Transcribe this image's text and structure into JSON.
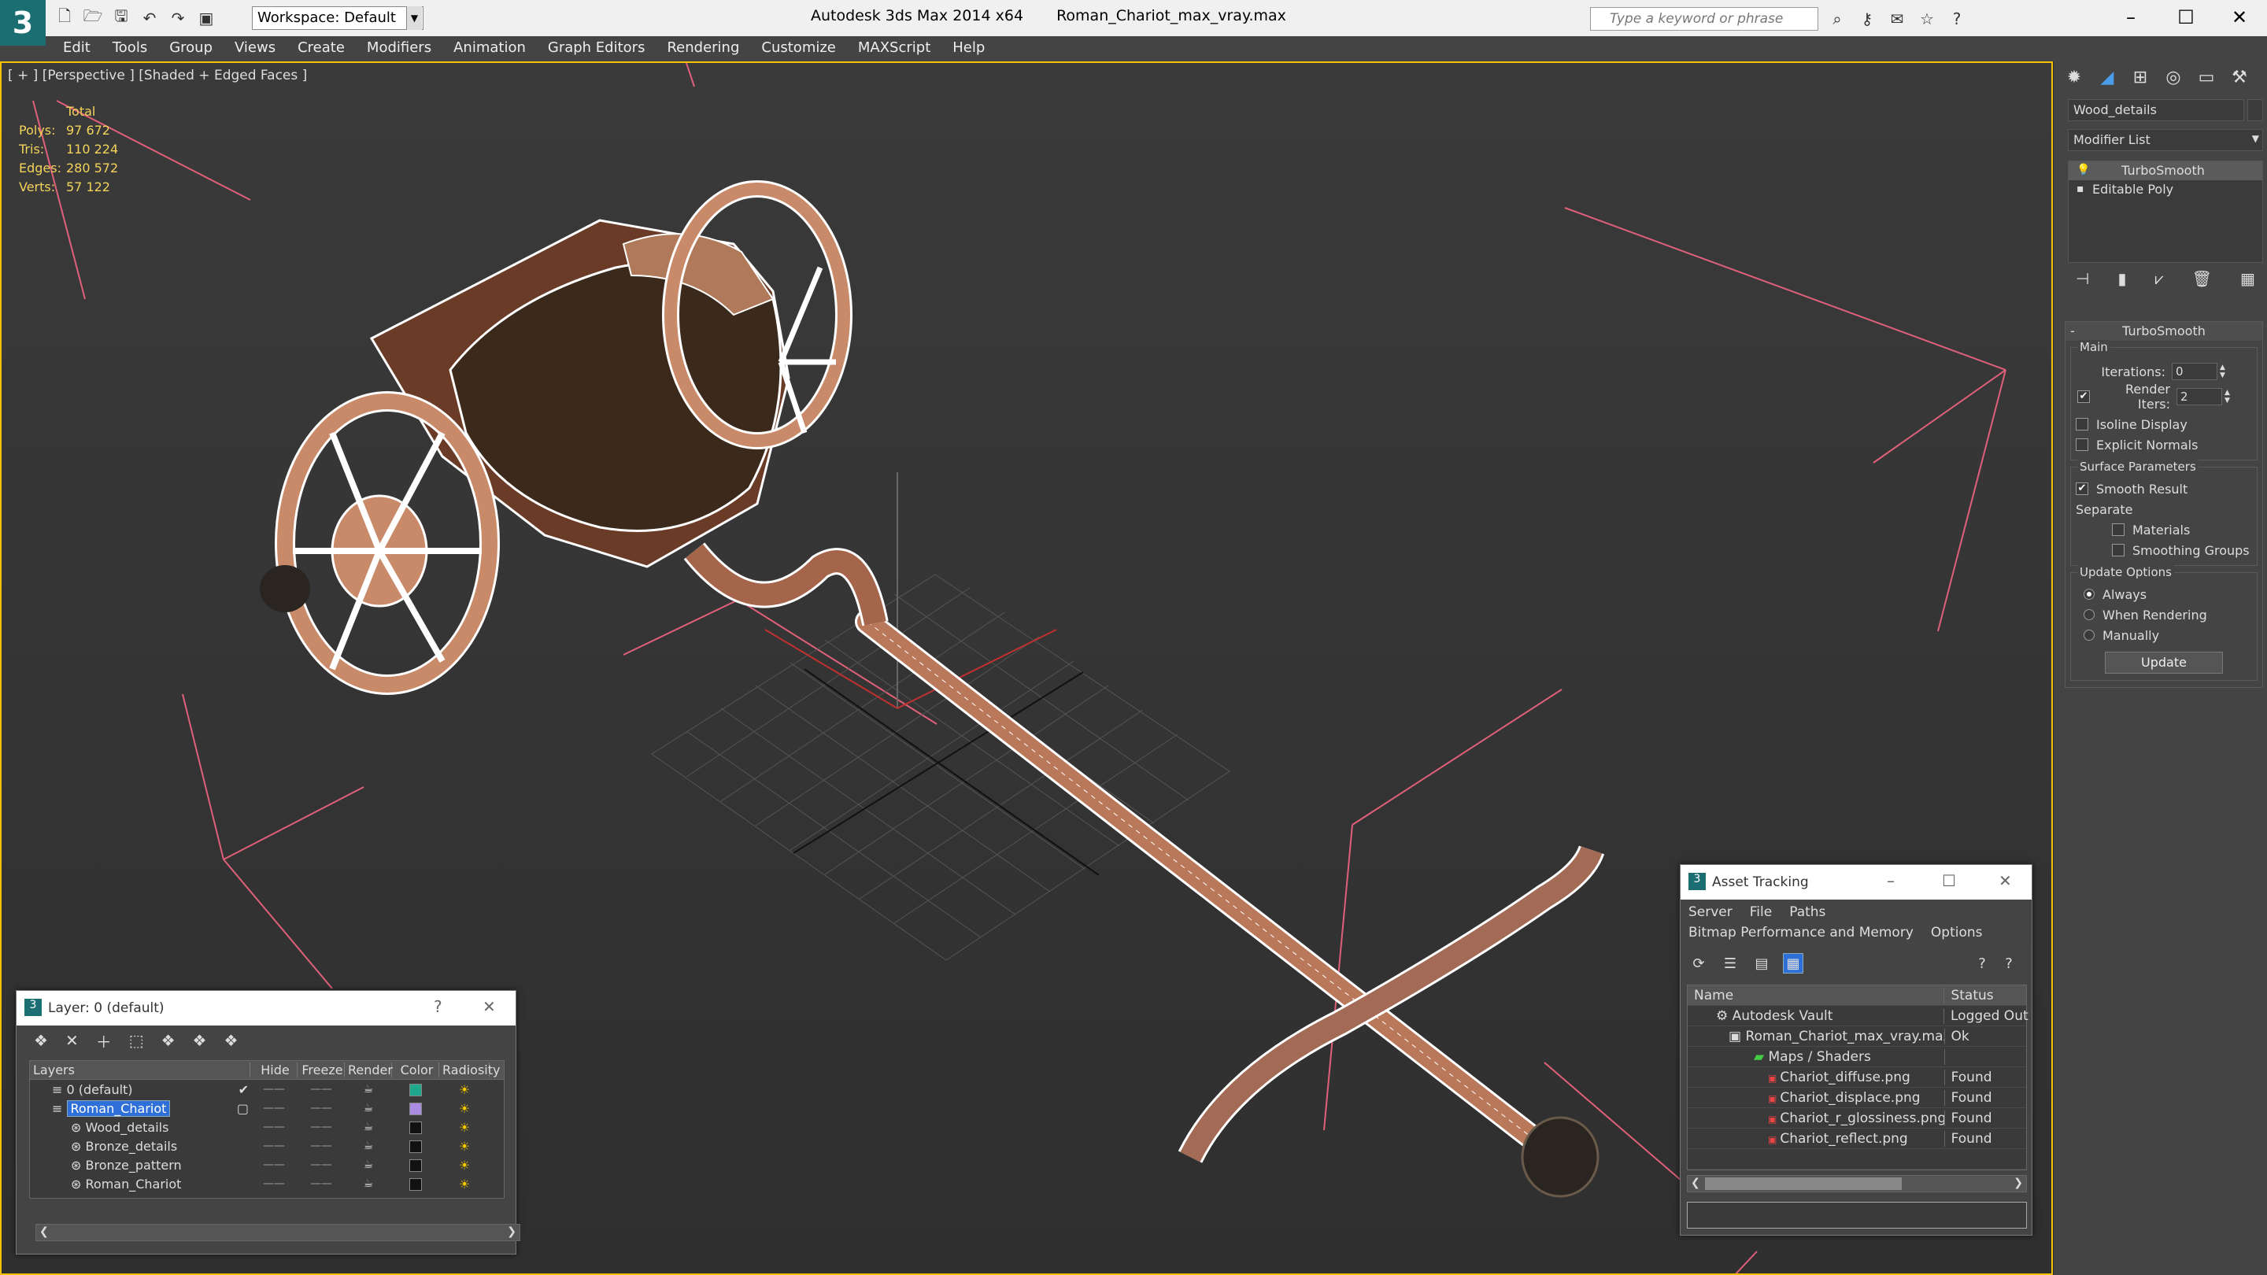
{
  "app": {
    "title": "Autodesk 3ds Max  2014 x64",
    "file_name": "Roman_Chariot_max_vray.max",
    "workspace": "Workspace: Default",
    "search_placeholder": "Type a keyword or phrase"
  },
  "menu": [
    "Edit",
    "Tools",
    "Group",
    "Views",
    "Create",
    "Modifiers",
    "Animation",
    "Graph Editors",
    "Rendering",
    "Customize",
    "MAXScript",
    "Help"
  ],
  "viewport": {
    "label": "[ + ] [Perspective ] [Shaded + Edged Faces ]",
    "stats": {
      "header": "Total",
      "rows": [
        {
          "label": "Polys:",
          "value": "97 672"
        },
        {
          "label": "Tris:",
          "value": "110 224"
        },
        {
          "label": "Edges:",
          "value": "280 572"
        },
        {
          "label": "Verts:",
          "value": "57 122"
        }
      ]
    }
  },
  "command_panel": {
    "object_name": "Wood_details",
    "modifier_list": "Modifier List",
    "stack": [
      "TurboSmooth",
      "Editable Poly"
    ],
    "rollout_title": "TurboSmooth",
    "main_group": "Main",
    "iterations_label": "Iterations:",
    "iterations_value": "0",
    "render_iters_label": "Render Iters:",
    "render_iters_value": "2",
    "isoline": "Isoline Display",
    "explicit_normals": "Explicit Normals",
    "surface_group": "Surface Parameters",
    "smooth_result": "Smooth Result",
    "separate": "Separate",
    "materials": "Materials",
    "smoothing_groups": "Smoothing Groups",
    "update_group": "Update Options",
    "always": "Always",
    "when_rendering": "When Rendering",
    "manually": "Manually",
    "update_button": "Update"
  },
  "layer_dialog": {
    "title": "Layer: 0 (default)",
    "help": "?",
    "columns": [
      "Layers",
      "Hide",
      "Freeze",
      "Render",
      "Color",
      "Radiosity"
    ],
    "rows": [
      {
        "name": "0 (default)",
        "color": "#1fa88c",
        "indent": 1,
        "selected": false,
        "check": "✔"
      },
      {
        "name": "Roman_Chariot",
        "color": "#a98ce0",
        "indent": 1,
        "selected": true,
        "check": "▢"
      },
      {
        "name": "Wood_details",
        "color": "#111111",
        "indent": 2,
        "selected": false,
        "check": ""
      },
      {
        "name": "Bronze_details",
        "color": "#111111",
        "indent": 2,
        "selected": false,
        "check": ""
      },
      {
        "name": "Bronze_pattern",
        "color": "#111111",
        "indent": 2,
        "selected": false,
        "check": ""
      },
      {
        "name": "Roman_Chariot",
        "color": "#111111",
        "indent": 2,
        "selected": false,
        "check": ""
      }
    ]
  },
  "asset_dialog": {
    "title": "Asset Tracking",
    "menu1": [
      "Server",
      "File",
      "Paths"
    ],
    "menu2": [
      "Bitmap Performance and Memory",
      "Options"
    ],
    "columns": [
      "Name",
      "Status"
    ],
    "rows": [
      {
        "name": "Autodesk Vault",
        "status": "Logged Out",
        "indent": 2
      },
      {
        "name": "Roman_Chariot_max_vray.max",
        "status": "Ok",
        "indent": 3
      },
      {
        "name": "Maps / Shaders",
        "status": "",
        "indent": 4
      },
      {
        "name": "Chariot_diffuse.png",
        "status": "Found",
        "indent": 5
      },
      {
        "name": "Chariot_displace.png",
        "status": "Found",
        "indent": 5
      },
      {
        "name": "Chariot_r_glossiness.png",
        "status": "Found",
        "indent": 5
      },
      {
        "name": "Chariot_reflect.png",
        "status": "Found",
        "indent": 5
      },
      {
        "name": "",
        "status": "",
        "indent": 0
      }
    ]
  },
  "colors": {
    "accent_yellow": "#f2c300",
    "selection_blue": "#2e6fd8",
    "wire_pink": "#e0607a"
  }
}
